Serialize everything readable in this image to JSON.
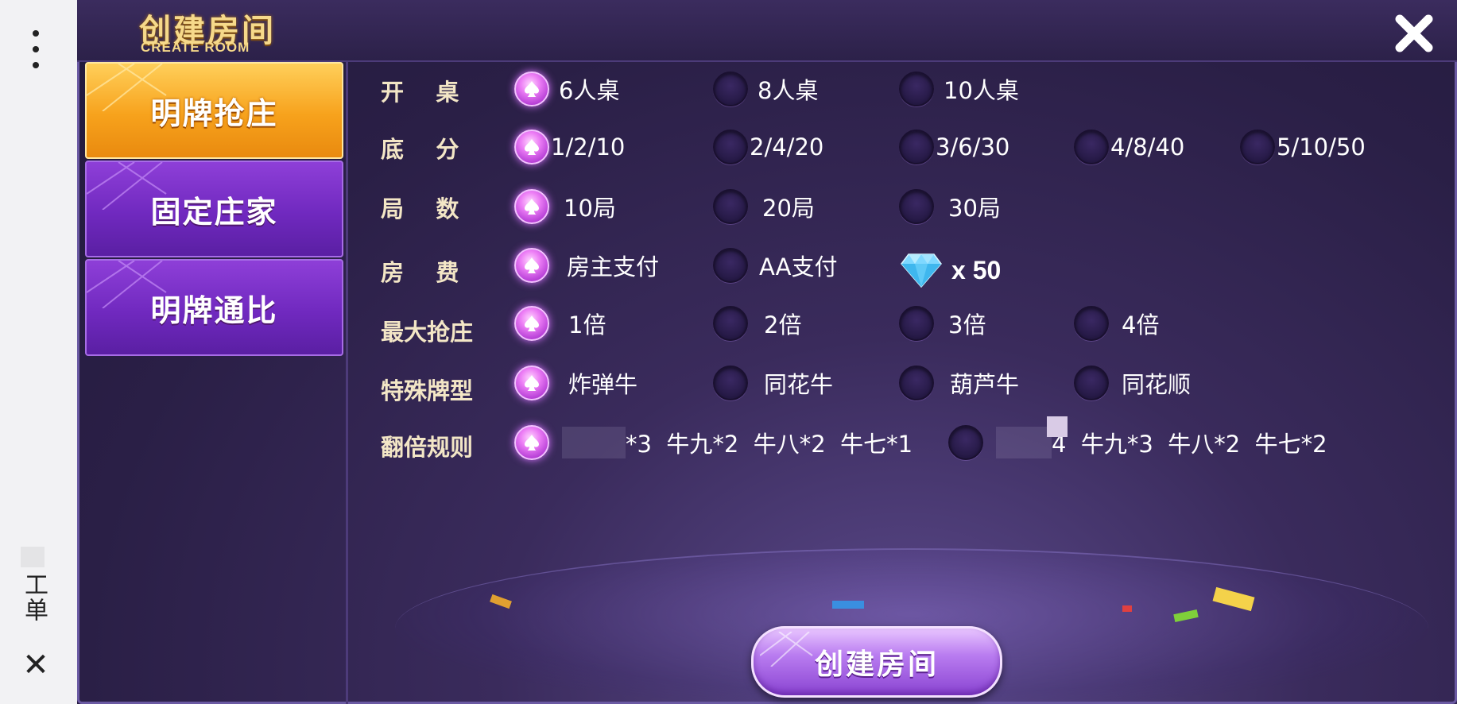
{
  "system": {
    "text": "工单",
    "close_glyph": "✕"
  },
  "dialog": {
    "title_cn": "创建房间",
    "title_en": "CREATE ROOM"
  },
  "tabs": [
    {
      "label": "明牌抢庄",
      "active": true
    },
    {
      "label": "固定庄家",
      "active": false
    },
    {
      "label": "明牌通比",
      "active": false
    }
  ],
  "options": {
    "table": {
      "label": "开    桌",
      "choices": [
        {
          "text": "6人桌",
          "selected": true
        },
        {
          "text": "8人桌",
          "selected": false
        },
        {
          "text": "10人桌",
          "selected": false
        }
      ]
    },
    "base_score": {
      "label": "底    分",
      "choices": [
        {
          "text": "1/2/10",
          "selected": true
        },
        {
          "text": "2/4/20",
          "selected": false
        },
        {
          "text": "3/6/30",
          "selected": false
        },
        {
          "text": "4/8/40",
          "selected": false
        },
        {
          "text": "5/10/50",
          "selected": false
        }
      ]
    },
    "rounds": {
      "label": "局    数",
      "choices": [
        {
          "text": "10局",
          "selected": true
        },
        {
          "text": "20局",
          "selected": false
        },
        {
          "text": "30局",
          "selected": false
        }
      ]
    },
    "room_fee": {
      "label": "房    费",
      "choices": [
        {
          "text": "房主支付",
          "selected": true
        },
        {
          "text": "AA支付",
          "selected": false
        }
      ],
      "diamond_count": "x 50"
    },
    "max_banker": {
      "label": "最大抢庄",
      "choices": [
        {
          "text": "1倍",
          "selected": true
        },
        {
          "text": "2倍",
          "selected": false
        },
        {
          "text": "3倍",
          "selected": false
        },
        {
          "text": "4倍",
          "selected": false
        }
      ]
    },
    "special_hands": {
      "label": "特殊牌型",
      "choices": [
        {
          "text": "炸弹牛",
          "selected": true
        },
        {
          "text": "同花牛",
          "selected": false
        },
        {
          "text": "葫芦牛",
          "selected": false
        },
        {
          "text": "同花顺",
          "selected": false
        }
      ]
    },
    "multiplier_rules": {
      "label": "翻倍规则",
      "choices": [
        {
          "text": "*3  牛九*2  牛八*2  牛七*1",
          "selected": true
        },
        {
          "text": "4  牛九*3  牛八*2  牛七*2",
          "selected": false
        }
      ]
    }
  },
  "create_button": {
    "label": "创建房间"
  },
  "colors": {
    "accent_gold": "#f6d98a",
    "tab_active": "#f7a21c",
    "tab_inactive": "#7029bf",
    "radio_selected": "#ec7ef5",
    "panel_bg": "#2a1f46"
  },
  "icons": {
    "close": "close-icon",
    "radio_selected": "spade-icon",
    "currency": "diamond-icon",
    "menu": "more-vertical-icon"
  }
}
